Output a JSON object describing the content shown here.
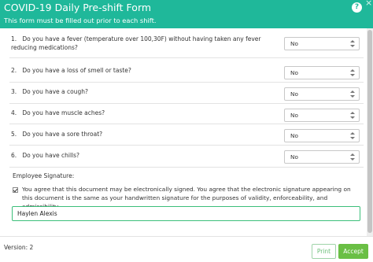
{
  "header": {
    "title": "COVID-19 Daily Pre-shift Form",
    "subtitle": "This form must be filled out prior to each shift.",
    "help_icon": "?",
    "close_icon": "×"
  },
  "questions": [
    {
      "number": "1.",
      "text": "Do you have a fever (temperature over 100,30F) without having taken any fever reducing medications?",
      "answer": "No"
    },
    {
      "number": "2.",
      "text": "Do you have a loss of smell or taste?",
      "answer": "No"
    },
    {
      "number": "3.",
      "text": "Do you have a cough?",
      "answer": "No"
    },
    {
      "number": "4.",
      "text": "Do you have muscle aches?",
      "answer": "No"
    },
    {
      "number": "5.",
      "text": "Do you have a sore throat?",
      "answer": "No"
    },
    {
      "number": "6.",
      "text": "Do you have chills?",
      "answer": "No"
    }
  ],
  "signature": {
    "label": "Employee Signature:",
    "agreement_checked": true,
    "agreement_text": "You agree that this document may be electronically signed. You agree that the electronic signature appearing on this document is the same as your handwritten signature for the purposes of validity, enforceability, and admissibility.",
    "value": "Haylen Alexis"
  },
  "footer": {
    "version": "Version: 2",
    "print_label": "Print",
    "accept_label": "Accept"
  },
  "colors": {
    "header_bg": "#1fb89a",
    "accept_bg": "#6abf45",
    "print_text": "#6cbf7a",
    "signature_border": "#3cbf7a"
  },
  "icons": {
    "help": "help-icon",
    "close": "close-icon",
    "dropdown": "chevron-updown-icon",
    "checkbox": "checkbox-checked-icon"
  }
}
